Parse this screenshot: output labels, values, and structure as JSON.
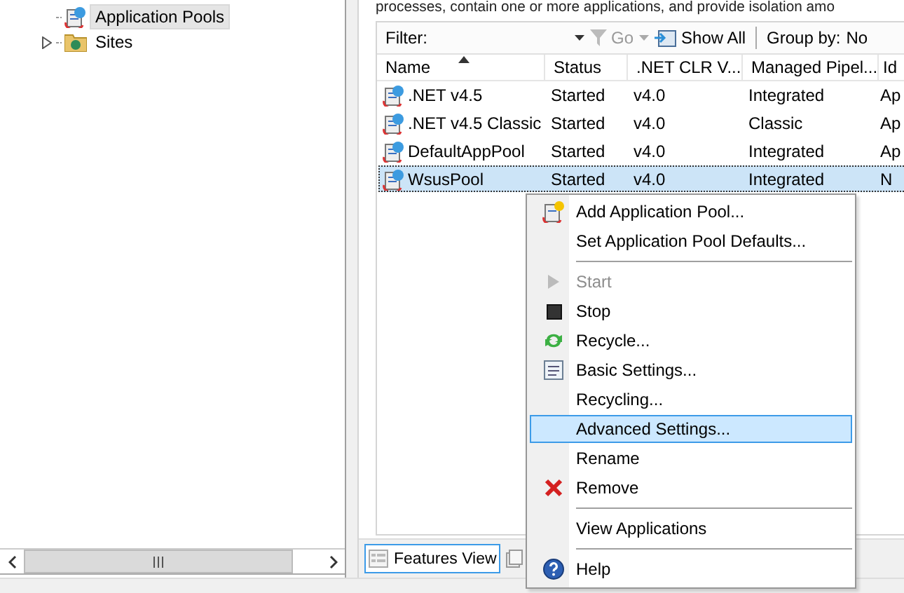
{
  "tree": {
    "items": [
      {
        "label": "Application Pools",
        "selected": true
      },
      {
        "label": "Sites",
        "selected": false,
        "expanded": false
      }
    ]
  },
  "description": "processes, contain one or more applications, and provide isolation amo",
  "filter_bar": {
    "label": "Filter:",
    "go": "Go",
    "show_all": "Show All",
    "group_by_label": "Group by:",
    "group_by_value": "No"
  },
  "list": {
    "columns": [
      {
        "label": "Name",
        "sorted": true
      },
      {
        "label": "Status",
        "sorted": false
      },
      {
        "label": ".NET CLR V...",
        "sorted": false
      },
      {
        "label": "Managed Pipel...",
        "sorted": false
      },
      {
        "label": "Id",
        "sorted": false
      }
    ],
    "rows": [
      {
        "cells": [
          ".NET v4.5",
          "Started",
          "v4.0",
          "Integrated",
          "Ap"
        ],
        "selected": false
      },
      {
        "cells": [
          ".NET v4.5 Classic",
          "Started",
          "v4.0",
          "Classic",
          "Ap"
        ],
        "selected": false
      },
      {
        "cells": [
          "DefaultAppPool",
          "Started",
          "v4.0",
          "Integrated",
          "Ap"
        ],
        "selected": false
      },
      {
        "cells": [
          "WsusPool",
          "Started",
          "v4.0",
          "Integrated",
          "N"
        ],
        "selected": true
      }
    ]
  },
  "view_tabs": [
    {
      "label": "Features View",
      "selected": true
    },
    {
      "selected": false
    }
  ],
  "context_menu": [
    {
      "kind": "item",
      "label": "Add Application Pool...",
      "disabled": false,
      "selected": false
    },
    {
      "kind": "item",
      "label": "Set Application Pool Defaults...",
      "disabled": false,
      "selected": false
    },
    {
      "kind": "separator"
    },
    {
      "kind": "item",
      "label": "Start",
      "disabled": true,
      "selected": false
    },
    {
      "kind": "item",
      "label": "Stop",
      "disabled": false,
      "selected": false
    },
    {
      "kind": "item",
      "label": "Recycle...",
      "disabled": false,
      "selected": false
    },
    {
      "kind": "item",
      "label": "Basic Settings...",
      "disabled": false,
      "selected": false
    },
    {
      "kind": "item",
      "label": "Recycling...",
      "disabled": false,
      "selected": false
    },
    {
      "kind": "item",
      "label": "Advanced Settings...",
      "disabled": false,
      "selected": true
    },
    {
      "kind": "item",
      "label": "Rename",
      "disabled": false,
      "selected": false
    },
    {
      "kind": "item",
      "label": "Remove",
      "disabled": false,
      "selected": false
    },
    {
      "kind": "separator"
    },
    {
      "kind": "item",
      "label": "View Applications",
      "disabled": false,
      "selected": false
    },
    {
      "kind": "separator"
    },
    {
      "kind": "item",
      "label": "Help",
      "disabled": false,
      "selected": false
    }
  ]
}
